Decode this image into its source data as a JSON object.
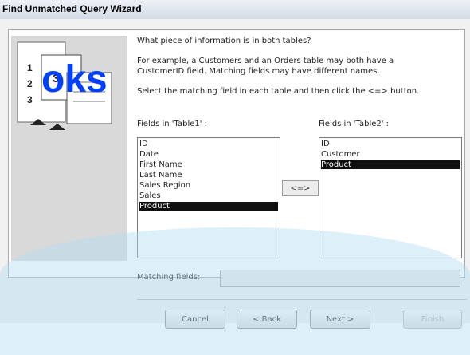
{
  "window": {
    "title": "Find Unmatched Query Wizard"
  },
  "instructions": {
    "line1": "What piece of information is in both tables?",
    "line2a": "For example, a Customers and an Orders table may both have a",
    "line2b": "CustomerID field. Matching fields may have different names.",
    "line3": "Select the matching field in each table and then click the <=> button."
  },
  "table1": {
    "label": "Fields in 'Table1' :",
    "fields": [
      "ID",
      "Date",
      "First Name",
      "Last Name",
      "Sales Region",
      "Sales",
      "Product"
    ],
    "selected": "Product"
  },
  "table2": {
    "label": "Fields in 'Table2' :",
    "fields": [
      "ID",
      "Customer",
      "Product"
    ],
    "selected": "Product"
  },
  "match_button": {
    "label": "<=>"
  },
  "matching": {
    "label": "Matching fields:",
    "value": ""
  },
  "buttons": {
    "cancel": "Cancel",
    "back": "< Back",
    "next": "Next >",
    "finish": "Finish"
  },
  "watermark": {
    "text": "oks"
  },
  "colors": {
    "selection": "#0f0f0f",
    "watermark": "#003fff",
    "overlay": "#b4dcf0"
  }
}
